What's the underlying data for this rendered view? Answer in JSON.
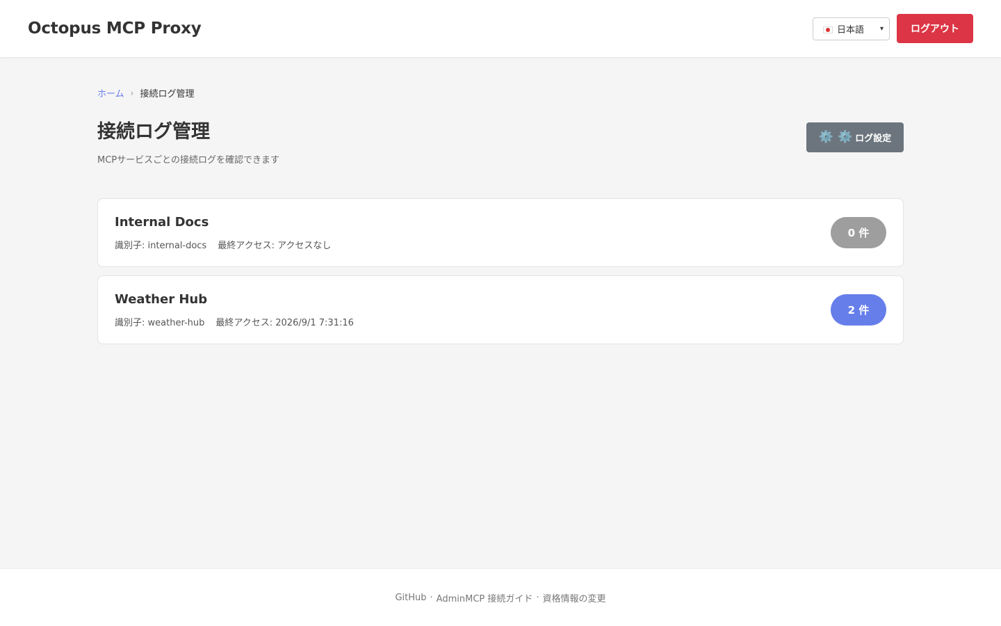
{
  "header": {
    "title": "Octopus MCP Proxy",
    "language": {
      "selected": "日本語",
      "flag_icon": "japan-flag-icon"
    },
    "logout_label": "ログアウト"
  },
  "breadcrumb": {
    "home": "ホーム",
    "separator": "›",
    "current": "接続ログ管理"
  },
  "page": {
    "title": "接続ログ管理",
    "subtitle": "MCPサービスごとの接続ログを確認できます",
    "settings_button": {
      "icons": "⚙️ ⚙️",
      "label": "ログ設定"
    }
  },
  "services": [
    {
      "name": "Internal Docs",
      "identifier": "識別子: internal-docs",
      "last_access": "最終アクセス: アクセスなし",
      "count": "0 件",
      "count_color": "#9e9e9e"
    },
    {
      "name": "Weather Hub",
      "identifier": "識別子: weather-hub",
      "last_access": "最終アクセス: 2026/9/1 7:31:16",
      "count": "2 件",
      "count_color": "#667eea"
    }
  ],
  "footer": {
    "links": [
      "GitHub",
      "AdminMCP 接続ガイド",
      "資格情報の変更"
    ],
    "separator": "·"
  },
  "colors": {
    "accent": "#667eea",
    "danger": "#dc3545",
    "secondary": "#6c757d"
  }
}
